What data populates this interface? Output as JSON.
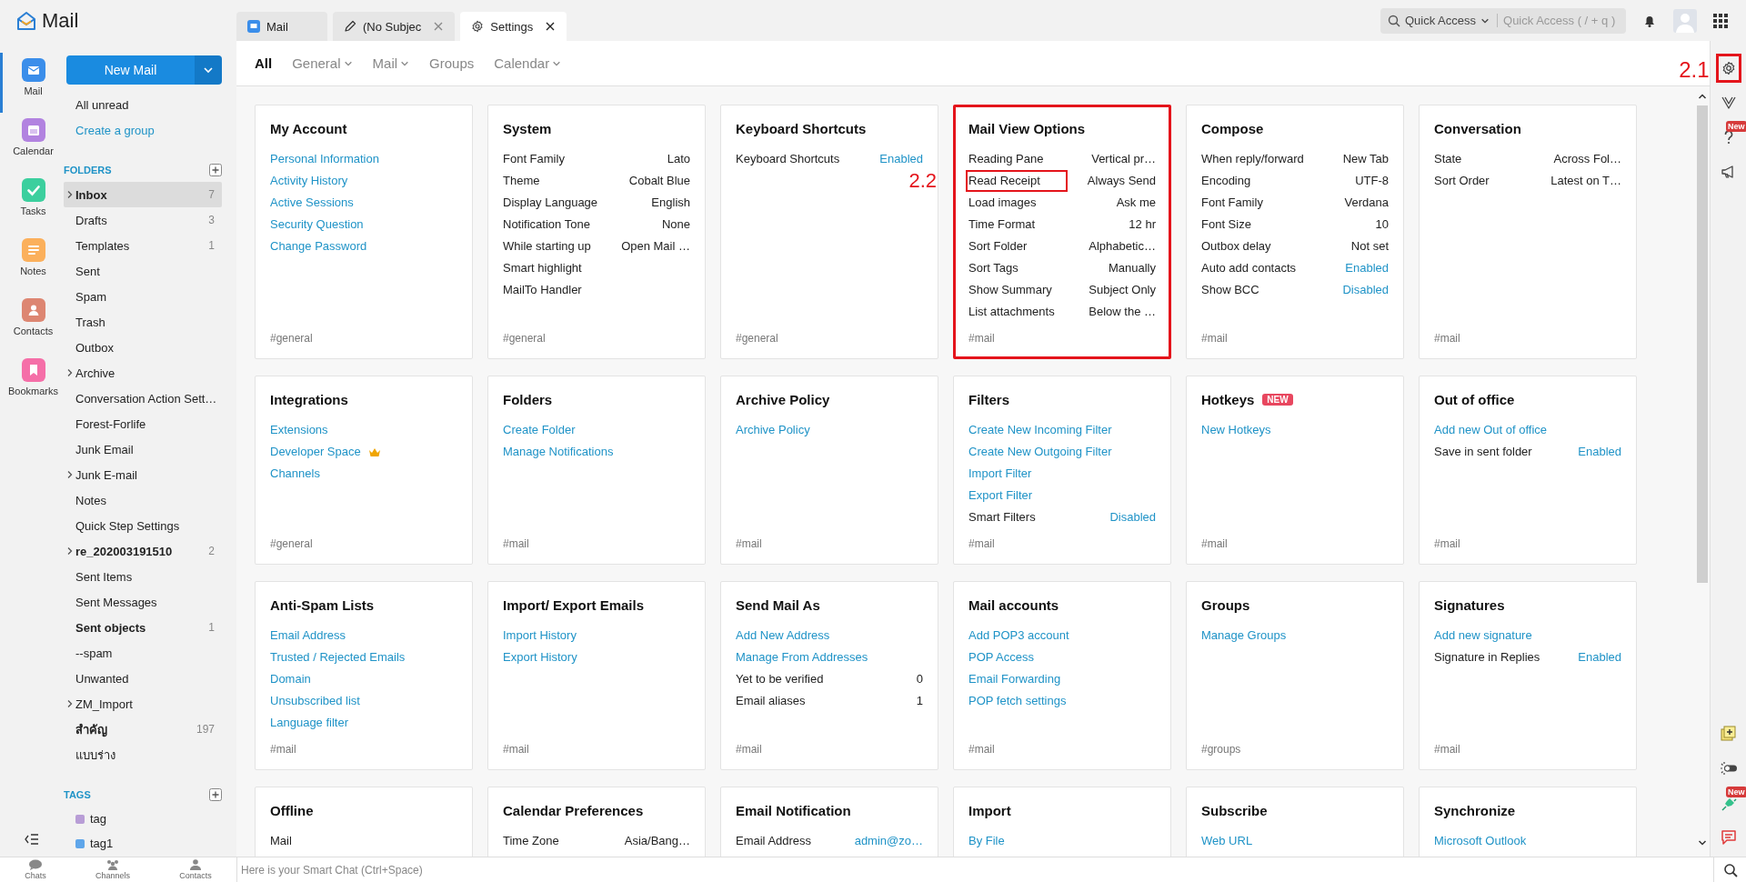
{
  "app": {
    "title": "Mail"
  },
  "tabs": [
    {
      "kind": "mail",
      "label": "Mail",
      "closable": false,
      "selected": false
    },
    {
      "kind": "draft",
      "label": "(No Subjec",
      "closable": true,
      "selected": false
    },
    {
      "kind": "settings",
      "label": "Settings",
      "closable": true,
      "selected": true
    }
  ],
  "quick_access": {
    "label": "Quick Access",
    "placeholder": "Quick Access ( / + q )"
  },
  "apps": [
    {
      "kind": "mail",
      "label": "Mail",
      "color": "#3b8eea",
      "selected": true
    },
    {
      "kind": "calendar",
      "label": "Calendar",
      "color": "#b283e0",
      "selected": false
    },
    {
      "kind": "tasks",
      "label": "Tasks",
      "color": "#3ccf9e",
      "selected": false
    },
    {
      "kind": "notes",
      "label": "Notes",
      "color": "#fbb05c",
      "selected": false
    },
    {
      "kind": "contacts",
      "label": "Contacts",
      "color": "#dd8672",
      "selected": false
    },
    {
      "kind": "bookmarks",
      "label": "Bookmarks",
      "color": "#f56fa8",
      "selected": false
    }
  ],
  "new_mail_button": "New Mail",
  "quick_links": [
    {
      "kind": "filter",
      "label": "All unread"
    },
    {
      "kind": "link",
      "label": "Create a group"
    }
  ],
  "folders": {
    "heading": "FOLDERS",
    "items": [
      {
        "name": "Inbox",
        "count": "7",
        "unread": true,
        "expandable": true,
        "selected": true
      },
      {
        "name": "Drafts",
        "count": "3",
        "unread": false,
        "expandable": false,
        "selected": false
      },
      {
        "name": "Templates",
        "count": "1",
        "unread": false,
        "expandable": false,
        "selected": false
      },
      {
        "name": "Sent",
        "unread": false,
        "expandable": false,
        "selected": false
      },
      {
        "name": "Spam",
        "unread": false,
        "expandable": false,
        "selected": false
      },
      {
        "name": "Trash",
        "unread": false,
        "expandable": false,
        "selected": false
      },
      {
        "name": "Outbox",
        "unread": false,
        "expandable": false,
        "selected": false
      },
      {
        "name": "Archive",
        "unread": false,
        "expandable": true,
        "selected": false
      },
      {
        "name": "Conversation Action Sett…",
        "unread": false,
        "expandable": false,
        "selected": false
      },
      {
        "name": "Forest-Forlife",
        "unread": false,
        "expandable": false,
        "selected": false
      },
      {
        "name": "Junk Email",
        "unread": false,
        "expandable": false,
        "selected": false
      },
      {
        "name": "Junk E-mail",
        "unread": false,
        "expandable": true,
        "selected": false
      },
      {
        "name": "Notes",
        "unread": false,
        "expandable": false,
        "selected": false
      },
      {
        "name": "Quick Step Settings",
        "unread": false,
        "expandable": false,
        "selected": false
      },
      {
        "name": "re_202003191510",
        "count": "2",
        "unread": true,
        "expandable": true,
        "selected": false
      },
      {
        "name": "Sent Items",
        "unread": false,
        "expandable": false,
        "selected": false
      },
      {
        "name": "Sent Messages",
        "unread": false,
        "expandable": false,
        "selected": false
      },
      {
        "name": "Sent objects",
        "count": "1",
        "unread": true,
        "expandable": false,
        "selected": false
      },
      {
        "name": "--spam",
        "unread": false,
        "expandable": false,
        "selected": false
      },
      {
        "name": "Unwanted",
        "unread": false,
        "expandable": false,
        "selected": false
      },
      {
        "name": "ZM_Import",
        "unread": false,
        "expandable": true,
        "selected": false
      },
      {
        "name": "สำคัญ",
        "count": "197",
        "unread": true,
        "expandable": false,
        "selected": false
      },
      {
        "name": "แบบร่าง",
        "unread": false,
        "expandable": false,
        "selected": false
      }
    ]
  },
  "tags": {
    "heading": "TAGS",
    "items": [
      {
        "name": "tag",
        "color": "#b89dd6"
      },
      {
        "name": "tag1",
        "color": "#5fa6ea"
      }
    ]
  },
  "settings_nav": [
    {
      "label": "All",
      "selected": true,
      "has_menu": false
    },
    {
      "label": "General",
      "selected": false,
      "has_menu": true
    },
    {
      "label": "Mail",
      "selected": false,
      "has_menu": true
    },
    {
      "label": "Groups",
      "selected": false,
      "has_menu": false
    },
    {
      "label": "Calendar",
      "selected": false,
      "has_menu": true
    }
  ],
  "cards": [
    {
      "title": "My Account",
      "highlighted": false,
      "tag": "#general",
      "rows": [
        {
          "kind": "link",
          "label": "Personal Information"
        },
        {
          "kind": "link",
          "label": "Activity History"
        },
        {
          "kind": "link",
          "label": "Active Sessions"
        },
        {
          "kind": "link",
          "label": "Security Question"
        },
        {
          "kind": "link",
          "label": "Change Password"
        }
      ]
    },
    {
      "title": "System",
      "highlighted": false,
      "tag": "#general",
      "rows": [
        {
          "kind": "pair",
          "label": "Font Family",
          "value": "Lato",
          "value_link": false
        },
        {
          "kind": "pair",
          "label": "Theme",
          "value": "Cobalt Blue",
          "value_link": false
        },
        {
          "kind": "pair",
          "label": "Display Language",
          "value": "English",
          "value_link": false
        },
        {
          "kind": "pair",
          "label": "Notification Tone",
          "value": "None",
          "value_link": false
        },
        {
          "kind": "pair",
          "label": "While starting up",
          "value": "Open Mail …",
          "value_link": false
        },
        {
          "kind": "pair",
          "label": "Smart highlight"
        },
        {
          "kind": "pair",
          "label": "MailTo Handler"
        }
      ]
    },
    {
      "title": "Keyboard Shortcuts",
      "highlighted": false,
      "tag": "#general",
      "rows": [
        {
          "kind": "pair",
          "label": "Keyboard Shortcuts",
          "value": "Enabled",
          "value_link": true
        }
      ]
    },
    {
      "title": "Mail View Options",
      "highlighted": true,
      "tag": "#mail",
      "rows": [
        {
          "kind": "pair",
          "label": "Reading Pane",
          "value": "Vertical pr…",
          "value_link": false
        },
        {
          "kind": "pair",
          "label": "Read Receipt",
          "value": "Always Send",
          "value_link": false,
          "callout": "2.2"
        },
        {
          "kind": "pair",
          "label": "Load images",
          "value": "Ask me",
          "value_link": false
        },
        {
          "kind": "pair",
          "label": "Time Format",
          "value": "12 hr",
          "value_link": false
        },
        {
          "kind": "pair",
          "label": "Sort Folder",
          "value": "Alphabetic…",
          "value_link": false
        },
        {
          "kind": "pair",
          "label": "Sort Tags",
          "value": "Manually",
          "value_link": false
        },
        {
          "kind": "pair",
          "label": "Show Summary",
          "value": "Subject Only",
          "value_link": false
        },
        {
          "kind": "pair",
          "label": "List attachments",
          "value": "Below the …",
          "value_link": false
        }
      ]
    },
    {
      "title": "Compose",
      "highlighted": false,
      "tag": "#mail",
      "rows": [
        {
          "kind": "pair",
          "label": "When reply/forward",
          "value": "New Tab",
          "value_link": false
        },
        {
          "kind": "pair",
          "label": "Encoding",
          "value": "UTF-8",
          "value_link": false
        },
        {
          "kind": "pair",
          "label": "Font Family",
          "value": "Verdana",
          "value_link": false
        },
        {
          "kind": "pair",
          "label": "Font Size",
          "value": "10",
          "value_link": false
        },
        {
          "kind": "pair",
          "label": "Outbox delay",
          "value": "Not set",
          "value_link": false
        },
        {
          "kind": "pair",
          "label": "Auto add contacts",
          "value": "Enabled",
          "value_link": true
        },
        {
          "kind": "pair",
          "label": "Show BCC",
          "value": "Disabled",
          "value_link": true
        }
      ]
    },
    {
      "title": "Conversation",
      "highlighted": false,
      "tag": "#mail",
      "rows": [
        {
          "kind": "pair",
          "label": "State",
          "value": "Across Fol…",
          "value_link": false
        },
        {
          "kind": "pair",
          "label": "Sort Order",
          "value": "Latest on T…",
          "value_link": false
        }
      ]
    },
    {
      "title": "Integrations",
      "highlighted": false,
      "tag": "#general",
      "rows": [
        {
          "kind": "link",
          "label": "Extensions"
        },
        {
          "kind": "premium-link",
          "label": "Developer Space"
        },
        {
          "kind": "link",
          "label": "Channels"
        }
      ]
    },
    {
      "title": "Folders",
      "highlighted": false,
      "tag": "#mail",
      "rows": [
        {
          "kind": "link",
          "label": "Create Folder"
        },
        {
          "kind": "link",
          "label": "Manage Notifications"
        }
      ]
    },
    {
      "title": "Archive Policy",
      "highlighted": false,
      "tag": "#mail",
      "rows": [
        {
          "kind": "link",
          "label": "Archive Policy"
        }
      ]
    },
    {
      "title": "Filters",
      "highlighted": false,
      "tag": "#mail",
      "rows": [
        {
          "kind": "link",
          "label": "Create New Incoming Filter"
        },
        {
          "kind": "link",
          "label": "Create New Outgoing Filter"
        },
        {
          "kind": "link",
          "label": "Import Filter"
        },
        {
          "kind": "link",
          "label": "Export Filter"
        },
        {
          "kind": "pair",
          "label": "Smart Filters",
          "value": "Disabled",
          "value_link": true
        }
      ]
    },
    {
      "title": "Hotkeys",
      "badge": "NEW",
      "highlighted": false,
      "tag": "#mail",
      "rows": [
        {
          "kind": "link",
          "label": "New Hotkeys"
        }
      ]
    },
    {
      "title": "Out of office",
      "highlighted": false,
      "tag": "#mail",
      "rows": [
        {
          "kind": "link",
          "label": "Add new Out of office"
        },
        {
          "kind": "pair",
          "label": "Save in sent folder",
          "value": "Enabled",
          "value_link": true
        }
      ]
    },
    {
      "title": "Anti-Spam Lists",
      "highlighted": false,
      "tag": "#mail",
      "rows": [
        {
          "kind": "link",
          "label": "Email Address"
        },
        {
          "kind": "link",
          "label": "Trusted / Rejected Emails"
        },
        {
          "kind": "link",
          "label": "Domain"
        },
        {
          "kind": "link",
          "label": "Unsubscribed list"
        },
        {
          "kind": "link",
          "label": "Language filter"
        }
      ]
    },
    {
      "title": "Import/ Export Emails",
      "highlighted": false,
      "tag": "#mail",
      "rows": [
        {
          "kind": "link",
          "label": "Import History"
        },
        {
          "kind": "link",
          "label": "Export History"
        }
      ]
    },
    {
      "title": "Send Mail As",
      "highlighted": false,
      "tag": "#mail",
      "rows": [
        {
          "kind": "link",
          "label": "Add New Address"
        },
        {
          "kind": "link",
          "label": "Manage From Addresses"
        },
        {
          "kind": "pair",
          "label": "Yet to be verified",
          "value": "0",
          "value_link": false
        },
        {
          "kind": "pair",
          "label": "Email aliases",
          "value": "1",
          "value_link": false
        }
      ]
    },
    {
      "title": "Mail accounts",
      "highlighted": false,
      "tag": "#mail",
      "rows": [
        {
          "kind": "link",
          "label": "Add POP3 account"
        },
        {
          "kind": "link",
          "label": "POP Access"
        },
        {
          "kind": "link",
          "label": "Email Forwarding"
        },
        {
          "kind": "link",
          "label": "POP fetch settings"
        }
      ]
    },
    {
      "title": "Groups",
      "highlighted": false,
      "tag": "#groups",
      "rows": [
        {
          "kind": "link",
          "label": "Manage Groups"
        }
      ]
    },
    {
      "title": "Signatures",
      "highlighted": false,
      "tag": "#mail",
      "rows": [
        {
          "kind": "link",
          "label": "Add new signature"
        },
        {
          "kind": "pair",
          "label": "Signature in Replies",
          "value": "Enabled",
          "value_link": true
        }
      ]
    },
    {
      "title": "Offline",
      "highlighted": false,
      "rows": [
        {
          "kind": "pair",
          "label": "Mail"
        }
      ]
    },
    {
      "title": "Calendar Preferences",
      "highlighted": false,
      "rows": [
        {
          "kind": "pair",
          "label": "Time Zone",
          "value": "Asia/Bang…",
          "value_link": false
        }
      ]
    },
    {
      "title": "Email Notification",
      "highlighted": false,
      "rows": [
        {
          "kind": "pair",
          "label": "Email Address",
          "value": "admin@zo…",
          "value_link": true
        }
      ]
    },
    {
      "title": "Import",
      "highlighted": false,
      "rows": [
        {
          "kind": "link",
          "label": "By File"
        }
      ]
    },
    {
      "title": "Subscribe",
      "highlighted": false,
      "rows": [
        {
          "kind": "link",
          "label": "Web URL"
        }
      ]
    },
    {
      "title": "Synchronize",
      "highlighted": false,
      "rows": [
        {
          "kind": "link",
          "label": "Microsoft Outlook"
        }
      ]
    }
  ],
  "right_strip": {
    "top": [
      {
        "kind": "settings",
        "callout": "2.1"
      },
      {
        "kind": "check"
      },
      {
        "kind": "help",
        "badge": "New"
      },
      {
        "kind": "announce"
      }
    ],
    "bottom": [
      {
        "kind": "note"
      },
      {
        "kind": "theme"
      },
      {
        "kind": "plug",
        "badge": "New"
      },
      {
        "kind": "chat"
      }
    ]
  },
  "bottom_bar": {
    "apps": [
      {
        "kind": "chats",
        "label": "Chats"
      },
      {
        "kind": "channels",
        "label": "Channels"
      },
      {
        "kind": "contacts",
        "label": "Contacts"
      }
    ],
    "smart_chat_placeholder": "Here is your Smart Chat (Ctrl+Space)"
  }
}
